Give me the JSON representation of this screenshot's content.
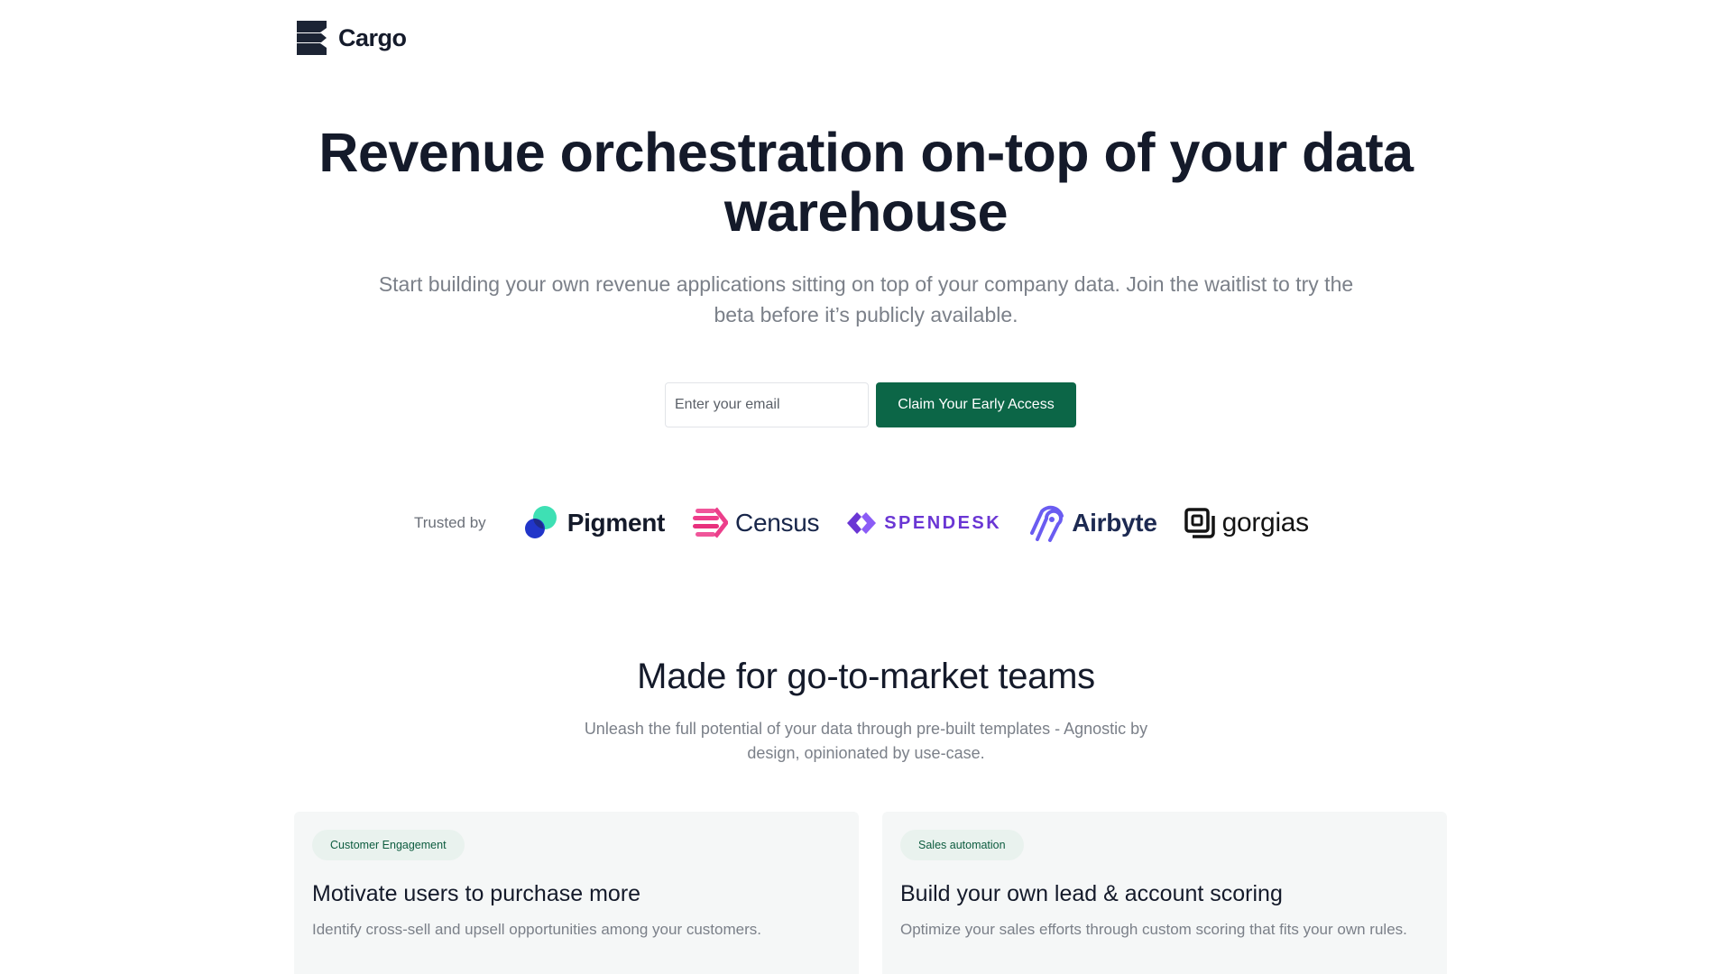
{
  "header": {
    "logo_text": "Cargo"
  },
  "hero": {
    "title": "Revenue orchestration on-top of your data warehouse",
    "subtitle": "Start building your own revenue applications sitting on top of your company data. Join the waitlist to try the beta before it’s publicly available."
  },
  "signup": {
    "email_placeholder": "Enter your email",
    "email_value": "",
    "cta_label": "Claim Your Early Access"
  },
  "trusted": {
    "label": "Trusted by",
    "brands": [
      "Pigment",
      "Census",
      "SPENDESK",
      "Airbyte",
      "gorgias"
    ]
  },
  "section": {
    "title": "Made for go-to-market teams",
    "subtitle": "Unleash the full potential of your data through pre-built templates - Agnostic by design, opinionated by use-case."
  },
  "cards": [
    {
      "tag": "Customer Engagement",
      "title": "Motivate users to purchase more",
      "text": "Identify cross-sell and upsell opportunities among your customers."
    },
    {
      "tag": "Sales automation",
      "title": "Build your own lead & account scoring",
      "text": "Optimize your sales efforts through custom scoring that fits your own rules."
    }
  ],
  "colors": {
    "brand_green": "#0c6647",
    "heading": "#141a2a",
    "muted_text": "#7b8089",
    "card_bg": "#f5f7f7",
    "tag_bg": "#e9f2ee"
  }
}
